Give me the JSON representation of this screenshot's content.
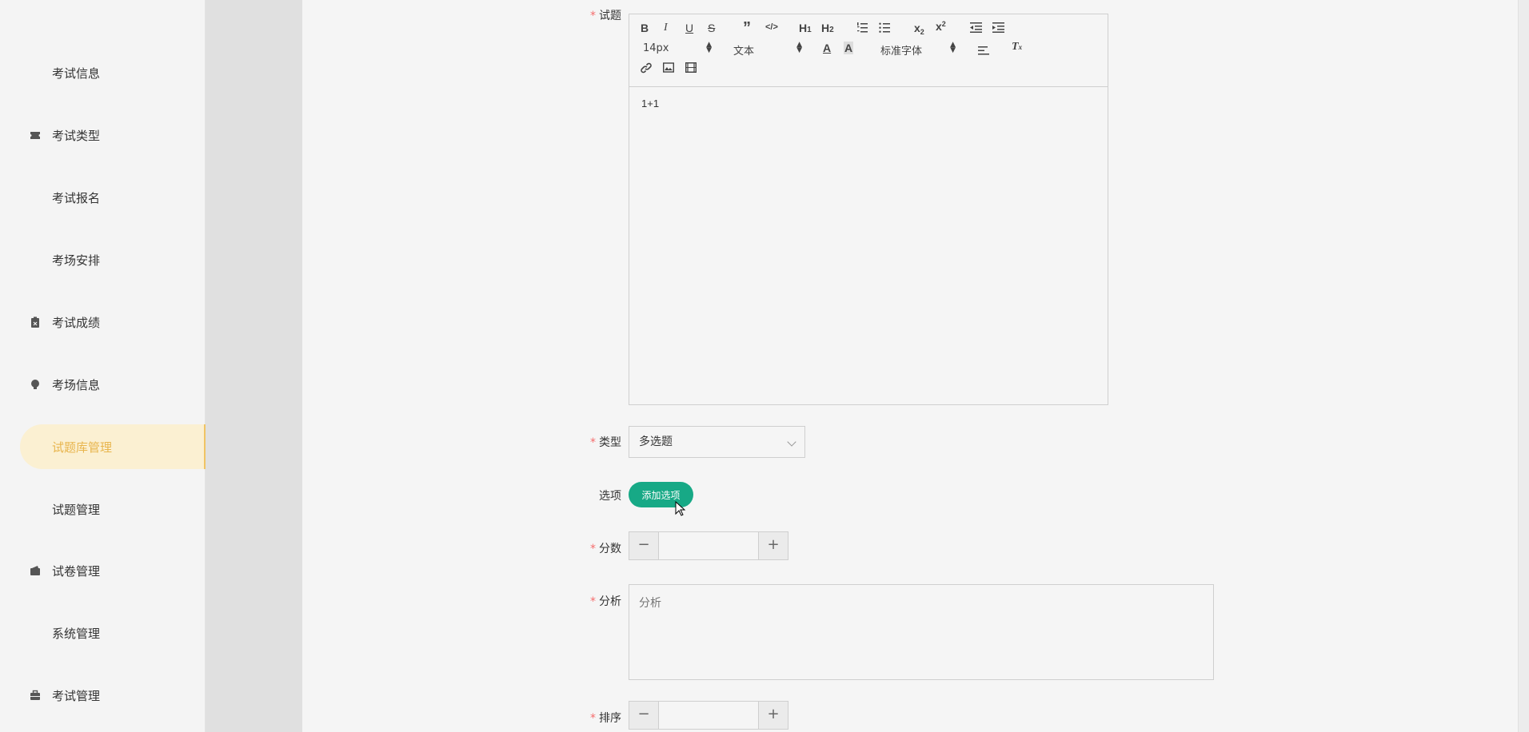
{
  "sidebar": {
    "items": [
      {
        "label": "考试信息",
        "icon": "grid-icon"
      },
      {
        "label": "考试类型",
        "icon": "ticket-icon"
      },
      {
        "label": "考试报名",
        "icon": "grid-icon"
      },
      {
        "label": "考场安排",
        "icon": "grid-icon"
      },
      {
        "label": "考试成绩",
        "icon": "clipboard-x-icon"
      },
      {
        "label": "考场信息",
        "icon": "bulb-icon"
      },
      {
        "label": "试题库管理",
        "icon": "grid-icon",
        "active": true
      },
      {
        "label": "试题管理",
        "icon": "grid-icon"
      },
      {
        "label": "试卷管理",
        "icon": "wallet-icon"
      },
      {
        "label": "系统管理",
        "icon": "grid-icon"
      },
      {
        "label": "考试管理",
        "icon": "briefcase-icon"
      }
    ],
    "active_color": "#e8b54d"
  },
  "form": {
    "question": {
      "label": "试题",
      "editor": {
        "font_size": "14px",
        "text_style": "文本",
        "font_family": "标准字体",
        "content": "1+1"
      }
    },
    "type": {
      "label": "类型",
      "value": "多选题"
    },
    "options": {
      "label": "选项",
      "add_button": "添加选项"
    },
    "score": {
      "label": "分数",
      "minus": "−",
      "plus": "+"
    },
    "analysis": {
      "label": "分析",
      "placeholder": "分析"
    },
    "order": {
      "label": "排序",
      "minus": "−",
      "plus": "+"
    }
  },
  "colors": {
    "accent": "#17a986",
    "required": "#f56c6c"
  }
}
